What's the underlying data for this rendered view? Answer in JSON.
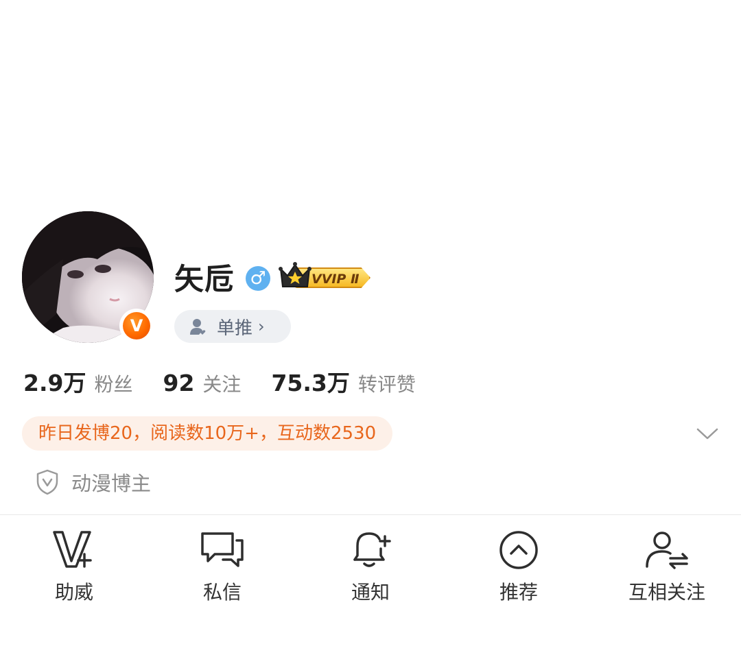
{
  "profile": {
    "username": "矢卮",
    "gender_symbol": "♂",
    "vip_label": "VVIP Ⅱ",
    "verified_badge": "V",
    "dantui_label": "单推",
    "dantui_chevron": "›"
  },
  "stats": [
    {
      "value": "2.9万",
      "label": "粉丝"
    },
    {
      "value": "92",
      "label": "关注"
    },
    {
      "value": "75.3万",
      "label": "转评赞"
    }
  ],
  "summary": "昨日发博20，阅读数10万+，互动数2530",
  "tagline": "动漫博主",
  "actions": [
    {
      "label": "助威",
      "icon": "v-plus-icon"
    },
    {
      "label": "私信",
      "icon": "chat-bubbles-icon"
    },
    {
      "label": "通知",
      "icon": "bell-plus-icon"
    },
    {
      "label": "推荐",
      "icon": "circle-chevron-up-icon"
    },
    {
      "label": "互相关注",
      "icon": "user-exchange-icon"
    }
  ],
  "colors": {
    "accent_orange": "#e8661c",
    "summary_bg": "#fdf0e8",
    "gender_blue": "#5fb1f0",
    "pill_bg": "#eef0f3"
  }
}
